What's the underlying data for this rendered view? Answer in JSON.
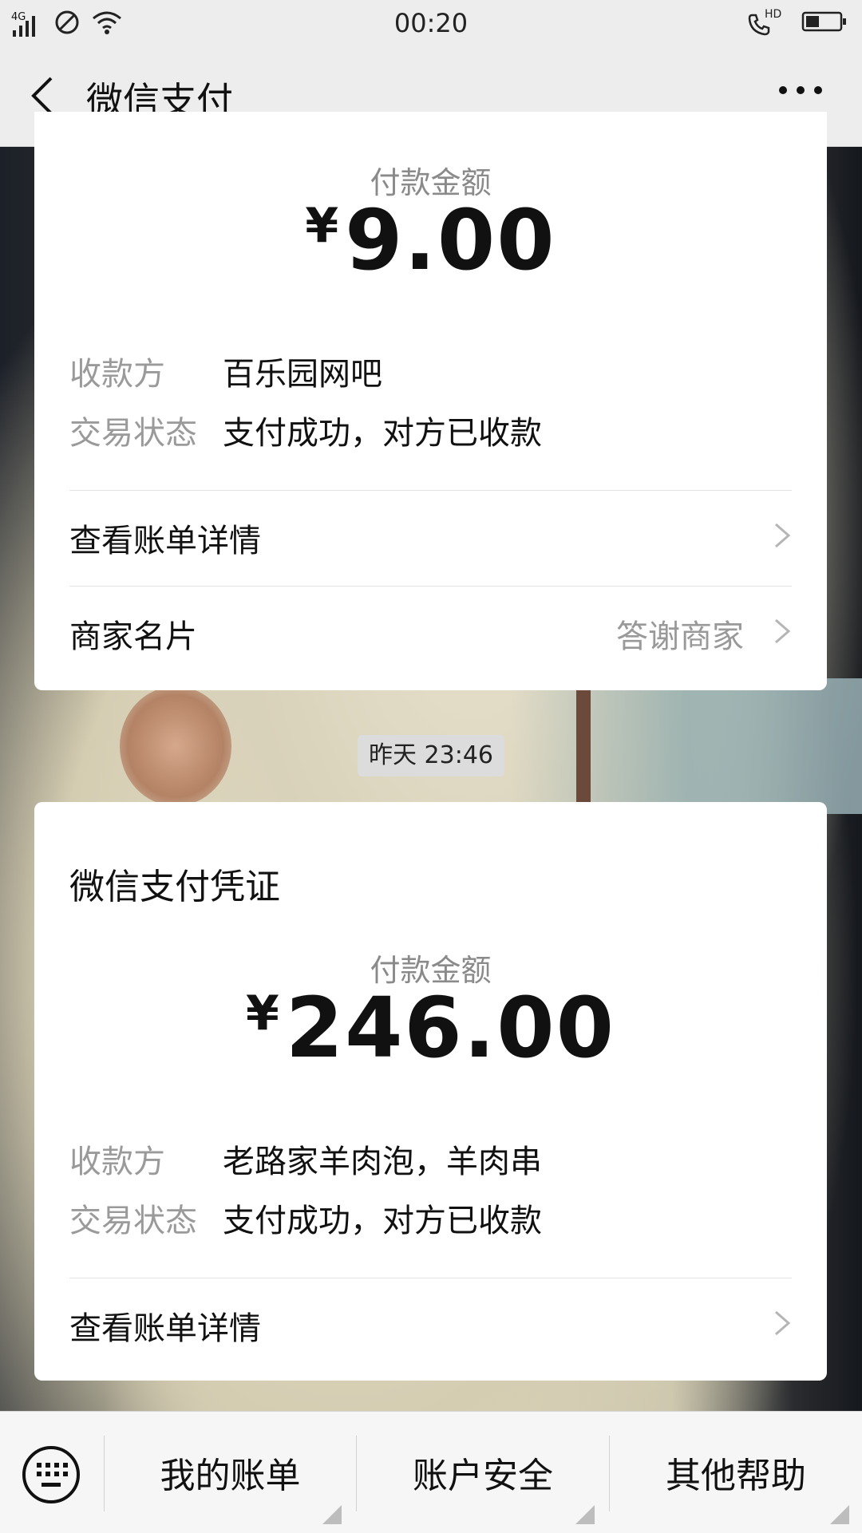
{
  "status_bar": {
    "network": "4G",
    "time": "00:20",
    "hd": "HD"
  },
  "header": {
    "title": "微信支付"
  },
  "card1": {
    "amount_label": "付款金额",
    "currency": "¥",
    "amount": "9.00",
    "payee_label": "收款方",
    "payee_value": "百乐园网吧",
    "status_label": "交易状态",
    "status_value": "支付成功，对方已收款",
    "bill_detail": "查看账单详情",
    "merchant_card": "商家名片",
    "thank_merchant": "答谢商家"
  },
  "timestamp": "昨天 23:46",
  "card2": {
    "title": "微信支付凭证",
    "amount_label": "付款金额",
    "currency": "¥",
    "amount": "246.00",
    "payee_label": "收款方",
    "payee_value": "老路家羊肉泡，羊肉串",
    "status_label": "交易状态",
    "status_value": "支付成功，对方已收款",
    "bill_detail": "查看账单详情"
  },
  "bottom_bar": {
    "items": [
      "我的账单",
      "账户安全",
      "其他帮助"
    ]
  },
  "icons": {
    "back": "back-arrow-icon",
    "more": "more-icon",
    "keyboard": "keyboard-icon",
    "chevron": "chevron-right-icon"
  }
}
